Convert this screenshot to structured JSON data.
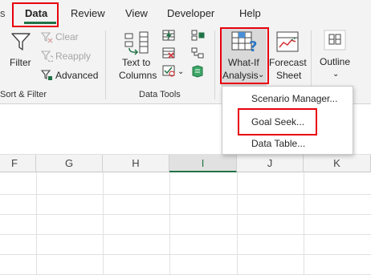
{
  "tabs": {
    "partial_label": "s",
    "data_label": "Data",
    "review_label": "Review",
    "view_label": "View",
    "developer_label": "Developer",
    "help_label": "Help"
  },
  "ribbon": {
    "sort_filter": {
      "filter_label": "Filter",
      "clear_label": "Clear",
      "reapply_label": "Reapply",
      "advanced_label": "Advanced",
      "group_label": "Sort & Filter"
    },
    "data_tools": {
      "text_to_label": "Text to",
      "columns_label": "Columns",
      "group_label": "Data Tools"
    },
    "forecast": {
      "whatif_line1": "What-If",
      "whatif_line2": "Analysis",
      "whatif_caret": "⌄",
      "forecast_line1": "Forecast",
      "forecast_line2": "Sheet"
    },
    "outline": {
      "outline_label": "Outline",
      "outline_caret": "⌄"
    }
  },
  "dropdown_menu": {
    "items": [
      {
        "label": "Scenario Manager..."
      },
      {
        "label": "Goal Seek..."
      },
      {
        "label": "Data Table..."
      }
    ]
  },
  "grid": {
    "columns": [
      "F",
      "G",
      "H",
      "I",
      "J",
      "K"
    ],
    "active_column": "I"
  },
  "colors": {
    "accent": "#217346",
    "highlight": "#e8000e",
    "ribbon_bg": "#f3f3f3"
  }
}
